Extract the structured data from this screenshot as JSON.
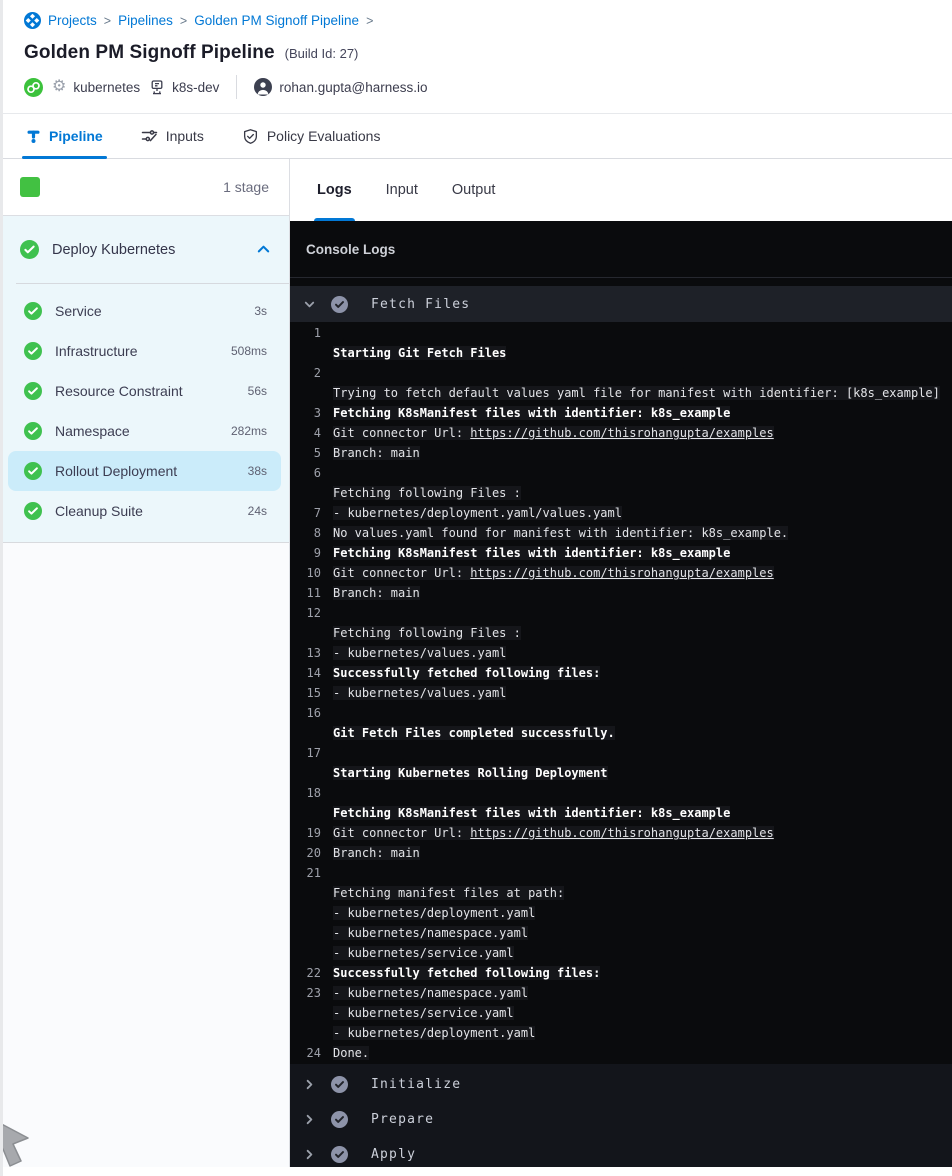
{
  "breadcrumb": {
    "items": [
      "Projects",
      "Pipelines",
      "Golden PM Signoff Pipeline"
    ]
  },
  "header": {
    "title": "Golden PM Signoff Pipeline",
    "build_id": "(Build Id: 27)",
    "deployment_type": "kubernetes",
    "environment": "k8s-dev",
    "user_email": "rohan.gupta@harness.io"
  },
  "tabs": [
    {
      "label": "Pipeline",
      "active": true
    },
    {
      "label": "Inputs",
      "active": false
    },
    {
      "label": "Policy Evaluations",
      "active": false
    }
  ],
  "stage_panel": {
    "stage_count_label": "1 stage",
    "group_label": "Deploy Kubernetes",
    "steps": [
      {
        "label": "Service",
        "duration": "3s",
        "selected": false
      },
      {
        "label": "Infrastructure",
        "duration": "508ms",
        "selected": false
      },
      {
        "label": "Resource Constraint",
        "duration": "56s",
        "selected": false
      },
      {
        "label": "Namespace",
        "duration": "282ms",
        "selected": false
      },
      {
        "label": "Rollout Deployment",
        "duration": "38s",
        "selected": true
      },
      {
        "label": "Cleanup Suite",
        "duration": "24s",
        "selected": false
      }
    ]
  },
  "log_panel": {
    "tabs": [
      {
        "label": "Logs",
        "active": true
      },
      {
        "label": "Input",
        "active": false
      },
      {
        "label": "Output",
        "active": false
      }
    ],
    "header": "Console Logs",
    "expanded_section": {
      "title": "Fetch Files",
      "entries": [
        {
          "n": "1",
          "rows": [
            [],
            [
              {
                "t": "Starting Git Fetch Files",
                "b": true
              }
            ]
          ]
        },
        {
          "n": "2",
          "rows": [
            [],
            [
              {
                "t": "Trying to fetch default values yaml file for manifest with identifier: [k8s_example]"
              }
            ]
          ]
        },
        {
          "n": "3",
          "rows": [
            [
              {
                "t": "Fetching K8sManifest files with identifier: k8s_example",
                "b": true
              }
            ]
          ]
        },
        {
          "n": "4",
          "rows": [
            [
              {
                "t": "Git connector Url: "
              },
              {
                "t": "https://github.com/thisrohangupta/examples",
                "u": true
              }
            ]
          ]
        },
        {
          "n": "5",
          "rows": [
            [
              {
                "t": "Branch: main"
              }
            ]
          ]
        },
        {
          "n": "6",
          "rows": [
            [],
            [
              {
                "t": "Fetching following Files :"
              }
            ]
          ]
        },
        {
          "n": "7",
          "rows": [
            [
              {
                "t": "- kubernetes/deployment.yaml/values.yaml"
              }
            ]
          ]
        },
        {
          "n": "8",
          "rows": [
            [
              {
                "t": "No values.yaml found for manifest with identifier: k8s_example."
              }
            ]
          ]
        },
        {
          "n": "9",
          "rows": [
            [
              {
                "t": "Fetching K8sManifest files with identifier: k8s_example",
                "b": true
              }
            ]
          ]
        },
        {
          "n": "10",
          "rows": [
            [
              {
                "t": "Git connector Url: "
              },
              {
                "t": "https://github.com/thisrohangupta/examples",
                "u": true
              }
            ]
          ]
        },
        {
          "n": "11",
          "rows": [
            [
              {
                "t": "Branch: main"
              }
            ]
          ]
        },
        {
          "n": "12",
          "rows": [
            [],
            [
              {
                "t": "Fetching following Files :"
              }
            ]
          ]
        },
        {
          "n": "13",
          "rows": [
            [
              {
                "t": "- kubernetes/values.yaml"
              }
            ]
          ]
        },
        {
          "n": "14",
          "rows": [
            [
              {
                "t": "Successfully fetched following files:",
                "b": true
              }
            ]
          ]
        },
        {
          "n": "15",
          "rows": [
            [
              {
                "t": "- kubernetes/values.yaml"
              }
            ]
          ]
        },
        {
          "n": "16",
          "rows": [
            [],
            [
              {
                "t": "Git Fetch Files completed successfully.",
                "b": true
              }
            ]
          ]
        },
        {
          "n": "17",
          "rows": [
            [],
            [
              {
                "t": "Starting Kubernetes Rolling Deployment",
                "b": true
              }
            ]
          ]
        },
        {
          "n": "18",
          "rows": [
            [],
            [
              {
                "t": "Fetching K8sManifest files with identifier: k8s_example",
                "b": true
              }
            ]
          ]
        },
        {
          "n": "19",
          "rows": [
            [
              {
                "t": "Git connector Url: "
              },
              {
                "t": "https://github.com/thisrohangupta/examples",
                "u": true
              }
            ]
          ]
        },
        {
          "n": "20",
          "rows": [
            [
              {
                "t": "Branch: main"
              }
            ]
          ]
        },
        {
          "n": "21",
          "rows": [
            [],
            [
              {
                "t": "Fetching manifest files at path:"
              }
            ],
            [
              {
                "t": "- kubernetes/deployment.yaml"
              }
            ],
            [
              {
                "t": "- kubernetes/namespace.yaml"
              }
            ],
            [
              {
                "t": "- kubernetes/service.yaml"
              }
            ]
          ]
        },
        {
          "n": "22",
          "rows": [
            [
              {
                "t": "Successfully fetched following files:",
                "b": true
              }
            ]
          ]
        },
        {
          "n": "23",
          "rows": [
            [
              {
                "t": "- kubernetes/namespace.yaml"
              }
            ],
            [
              {
                "t": "- kubernetes/service.yaml"
              }
            ],
            [
              {
                "t": "- kubernetes/deployment.yaml"
              }
            ]
          ]
        },
        {
          "n": "24",
          "rows": [
            [
              {
                "t": "Done."
              }
            ]
          ]
        }
      ]
    },
    "collapsed_sections": [
      {
        "title": "Initialize"
      },
      {
        "title": "Prepare"
      },
      {
        "title": "Apply"
      }
    ]
  },
  "colors": {
    "accent_blue": "#0278d5",
    "success_green": "#42c142",
    "selected_row": "#cbecfa",
    "console_bg": "#0a0b0d",
    "section_header_bg": "#1e2128"
  }
}
